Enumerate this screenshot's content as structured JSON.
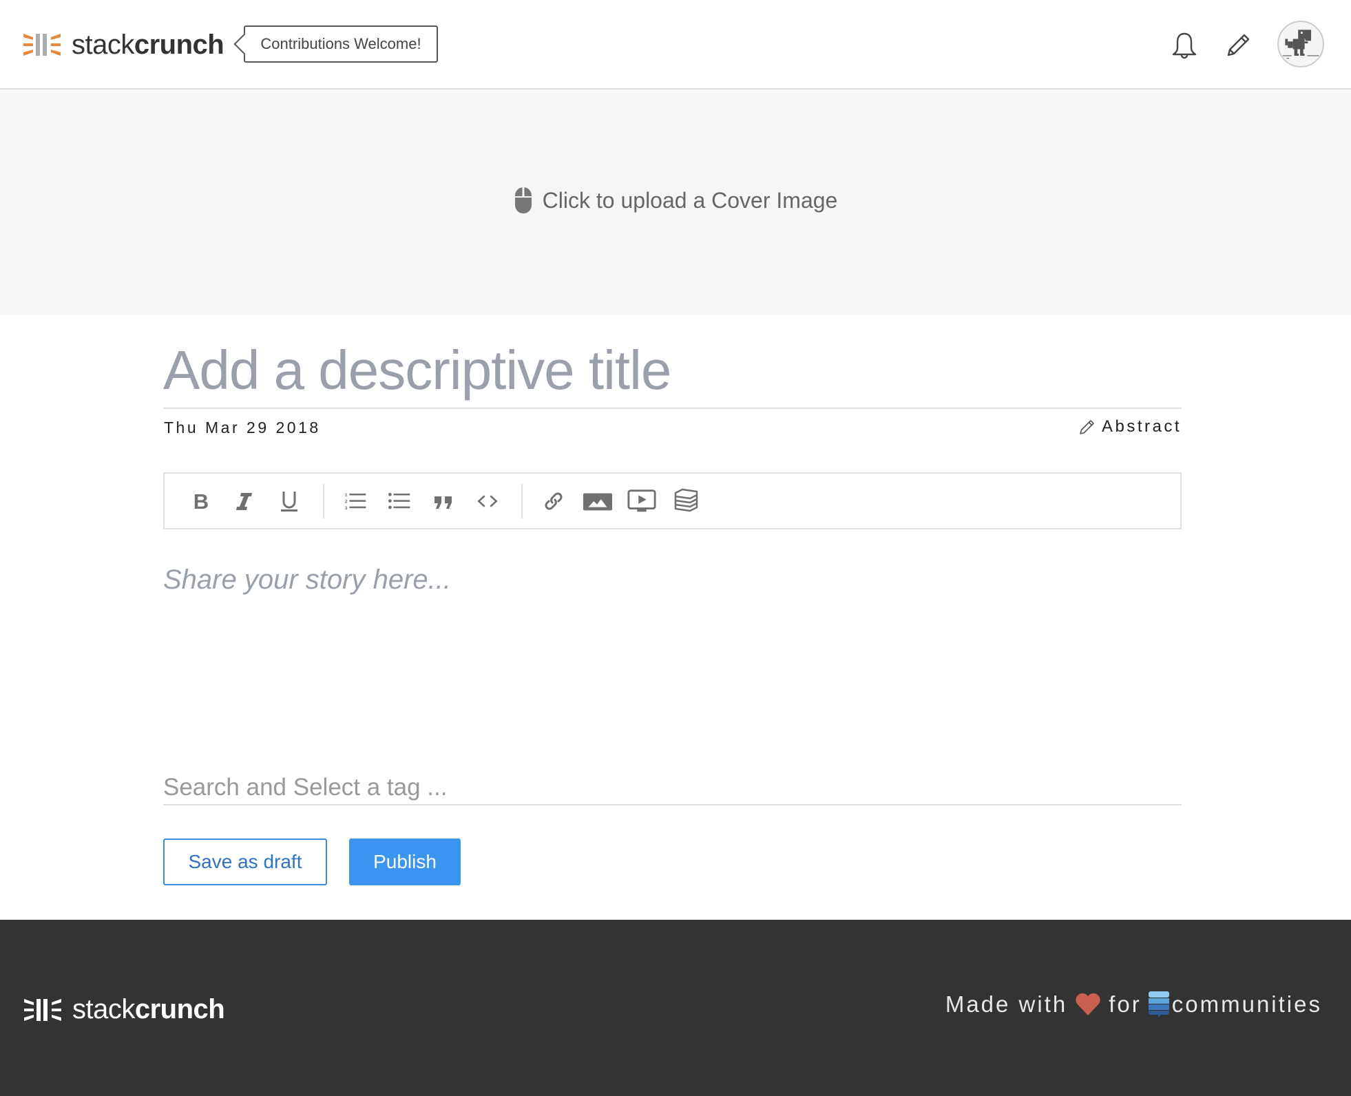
{
  "header": {
    "brand_light": "stack",
    "brand_bold": "crunch",
    "badge_label": "Contributions Welcome!",
    "icons": [
      "logo-icon",
      "bell-icon",
      "pencil-icon",
      "avatar"
    ]
  },
  "cover": {
    "upload_label": "Click to upload a Cover Image",
    "icon": "mouse-icon"
  },
  "editor": {
    "title_placeholder": "Add a descriptive title",
    "title_value": "",
    "date": "Thu Mar 29 2018",
    "abstract_label": "Abstract",
    "toolbar": {
      "groups": [
        [
          "bold",
          "italic",
          "underline"
        ],
        [
          "ordered-list",
          "unordered-list",
          "blockquote",
          "code"
        ],
        [
          "link",
          "image",
          "video",
          "embed-stack"
        ]
      ]
    },
    "story_placeholder": "Share your story here...",
    "tag_placeholder": "Search and Select a tag ...",
    "tag_value": ""
  },
  "actions": {
    "save_draft_label": "Save as draft",
    "publish_label": "Publish"
  },
  "footer": {
    "brand_light": "stack",
    "brand_bold": "crunch",
    "made_with": "Made with",
    "for": "for",
    "communities": "communities"
  },
  "colors": {
    "accent": "#3b95f0",
    "logo_orange": "#e8883a",
    "heart": "#c95f4f",
    "footer_bg": "#333333",
    "cover_bg": "#f6f6f6"
  }
}
